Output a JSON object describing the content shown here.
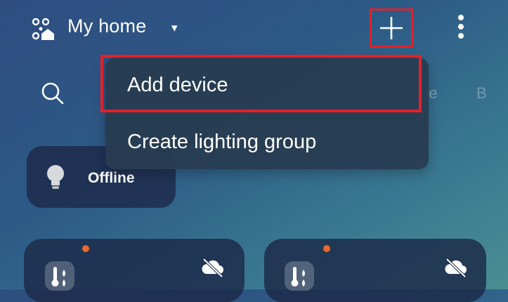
{
  "header": {
    "home_title": "My home",
    "caret": "▾",
    "add_button_icon": "plus-icon",
    "more_button_icon": "more-vertical-icon",
    "home_icon": "home-devices-icon"
  },
  "categories": {
    "peek_1": "ge",
    "peek_2": "B"
  },
  "menu": {
    "items": [
      {
        "label": "Add device"
      },
      {
        "label": "Create lighting group"
      }
    ]
  },
  "tiles": {
    "offline_label": "Offline"
  },
  "colors": {
    "highlight": "#e3202a",
    "status_dot": "#e86a2b"
  }
}
